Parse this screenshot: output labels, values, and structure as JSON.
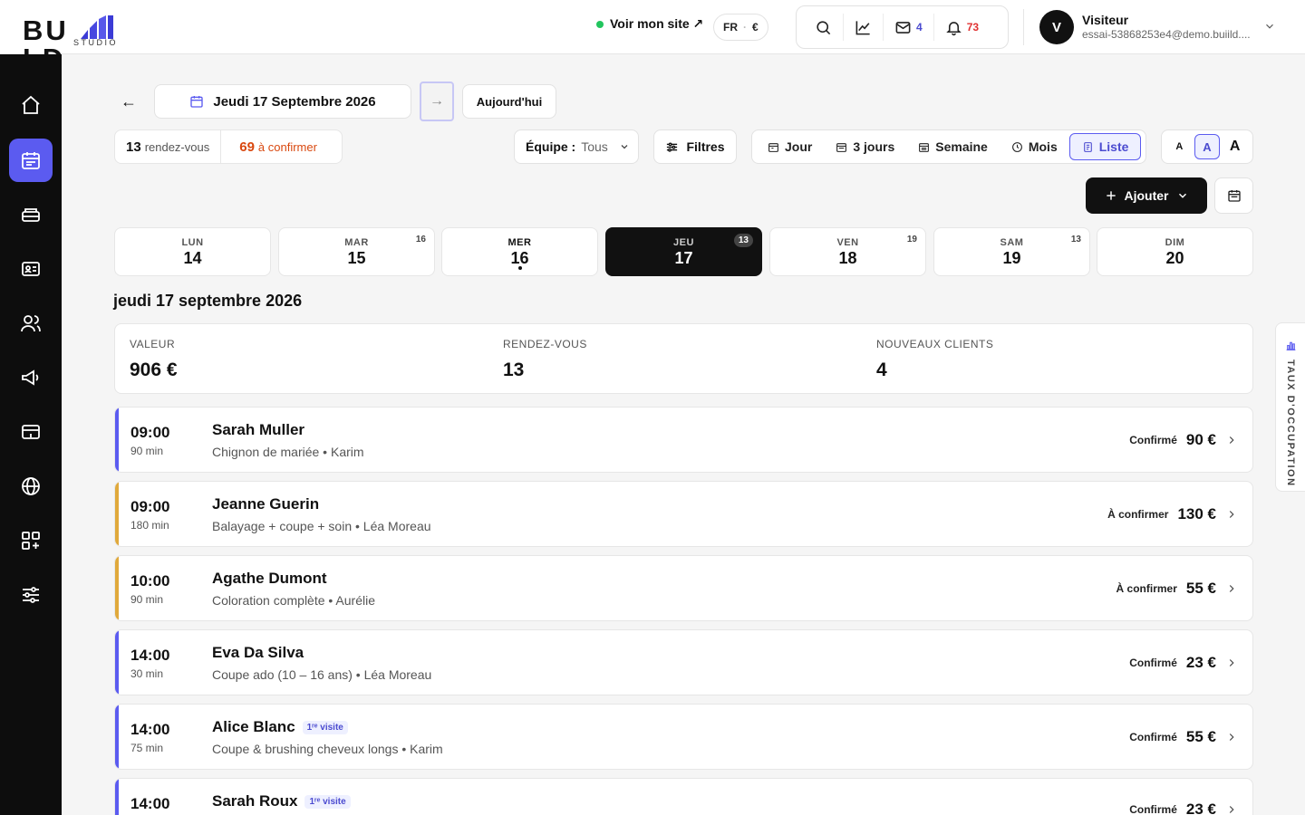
{
  "brand": {
    "logo_left": "BU",
    "logo_right": "LD",
    "logo_sub": "STUDIO"
  },
  "header": {
    "site_link": "Voir mon site ↗",
    "lang": "FR",
    "currency": "€",
    "messages_count": "4",
    "notifications_count": "73",
    "user_initial": "V",
    "user_name": "Visiteur",
    "user_email": "essai-53868253e4@demo.buiild...."
  },
  "toolbar": {
    "back": "←",
    "date_label": "Jeudi 17 Septembre 2026",
    "next": "→",
    "today": "Aujourd'hui",
    "appointments_count": "13",
    "appointments_label": "rendez-vous",
    "to_confirm_count": "69",
    "to_confirm_label": "à confirmer",
    "team_label": "Équipe :",
    "team_value": "Tous",
    "filters": "Filtres",
    "views": [
      "Jour",
      "3 jours",
      "Semaine",
      "Mois",
      "Liste"
    ],
    "active_view": "Liste",
    "font_sizes": [
      "A",
      "A",
      "A"
    ],
    "add": "Ajouter"
  },
  "days": [
    {
      "name": "LUN",
      "num": "14",
      "count": ""
    },
    {
      "name": "MAR",
      "num": "15",
      "count": "16"
    },
    {
      "name": "MER",
      "num": "16",
      "count": ""
    },
    {
      "name": "JEU",
      "num": "17",
      "count": "13"
    },
    {
      "name": "VEN",
      "num": "18",
      "count": "19"
    },
    {
      "name": "SAM",
      "num": "19",
      "count": "13"
    },
    {
      "name": "DIM",
      "num": "20",
      "count": ""
    }
  ],
  "section_title": "jeudi 17 septembre 2026",
  "stats": [
    {
      "label": "VALEUR",
      "value": "906 €"
    },
    {
      "label": "RENDEZ-VOUS",
      "value": "13"
    },
    {
      "label": "NOUVEAUX CLIENTS",
      "value": "4"
    }
  ],
  "appointments": [
    {
      "time": "09:00",
      "duration": "90 min",
      "client": "Sarah Muller",
      "badge": "",
      "service": "Chignon de mariée • Karim",
      "status": "Confirmé",
      "price": "90 €"
    },
    {
      "time": "09:00",
      "duration": "180 min",
      "client": "Jeanne Guerin",
      "badge": "",
      "service": "Balayage + coupe + soin • Léa Moreau",
      "status": "À confirmer",
      "price": "130 €"
    },
    {
      "time": "10:00",
      "duration": "90 min",
      "client": "Agathe Dumont",
      "badge": "",
      "service": "Coloration complète • Aurélie",
      "status": "À confirmer",
      "price": "55 €"
    },
    {
      "time": "14:00",
      "duration": "30 min",
      "client": "Eva Da Silva",
      "badge": "",
      "service": "Coupe ado (10 – 16 ans) • Léa Moreau",
      "status": "Confirmé",
      "price": "23 €"
    },
    {
      "time": "14:00",
      "duration": "75 min",
      "client": "Alice Blanc",
      "badge": "1ʳᵉ visite",
      "service": "Coupe & brushing cheveux longs • Karim",
      "status": "Confirmé",
      "price": "55 €"
    },
    {
      "time": "14:00",
      "duration": "",
      "client": "Sarah Roux",
      "badge": "1ʳᵉ visite",
      "service": "",
      "status": "Confirmé",
      "price": "23 €"
    }
  ],
  "side_tab": "TAUX D'OCCUPATION",
  "colors": {
    "accent": "#5b5bf0",
    "confirmed_bar": "#5b5bf0",
    "pending_bar": "#e0a93b",
    "warning_text": "#d9480f"
  }
}
